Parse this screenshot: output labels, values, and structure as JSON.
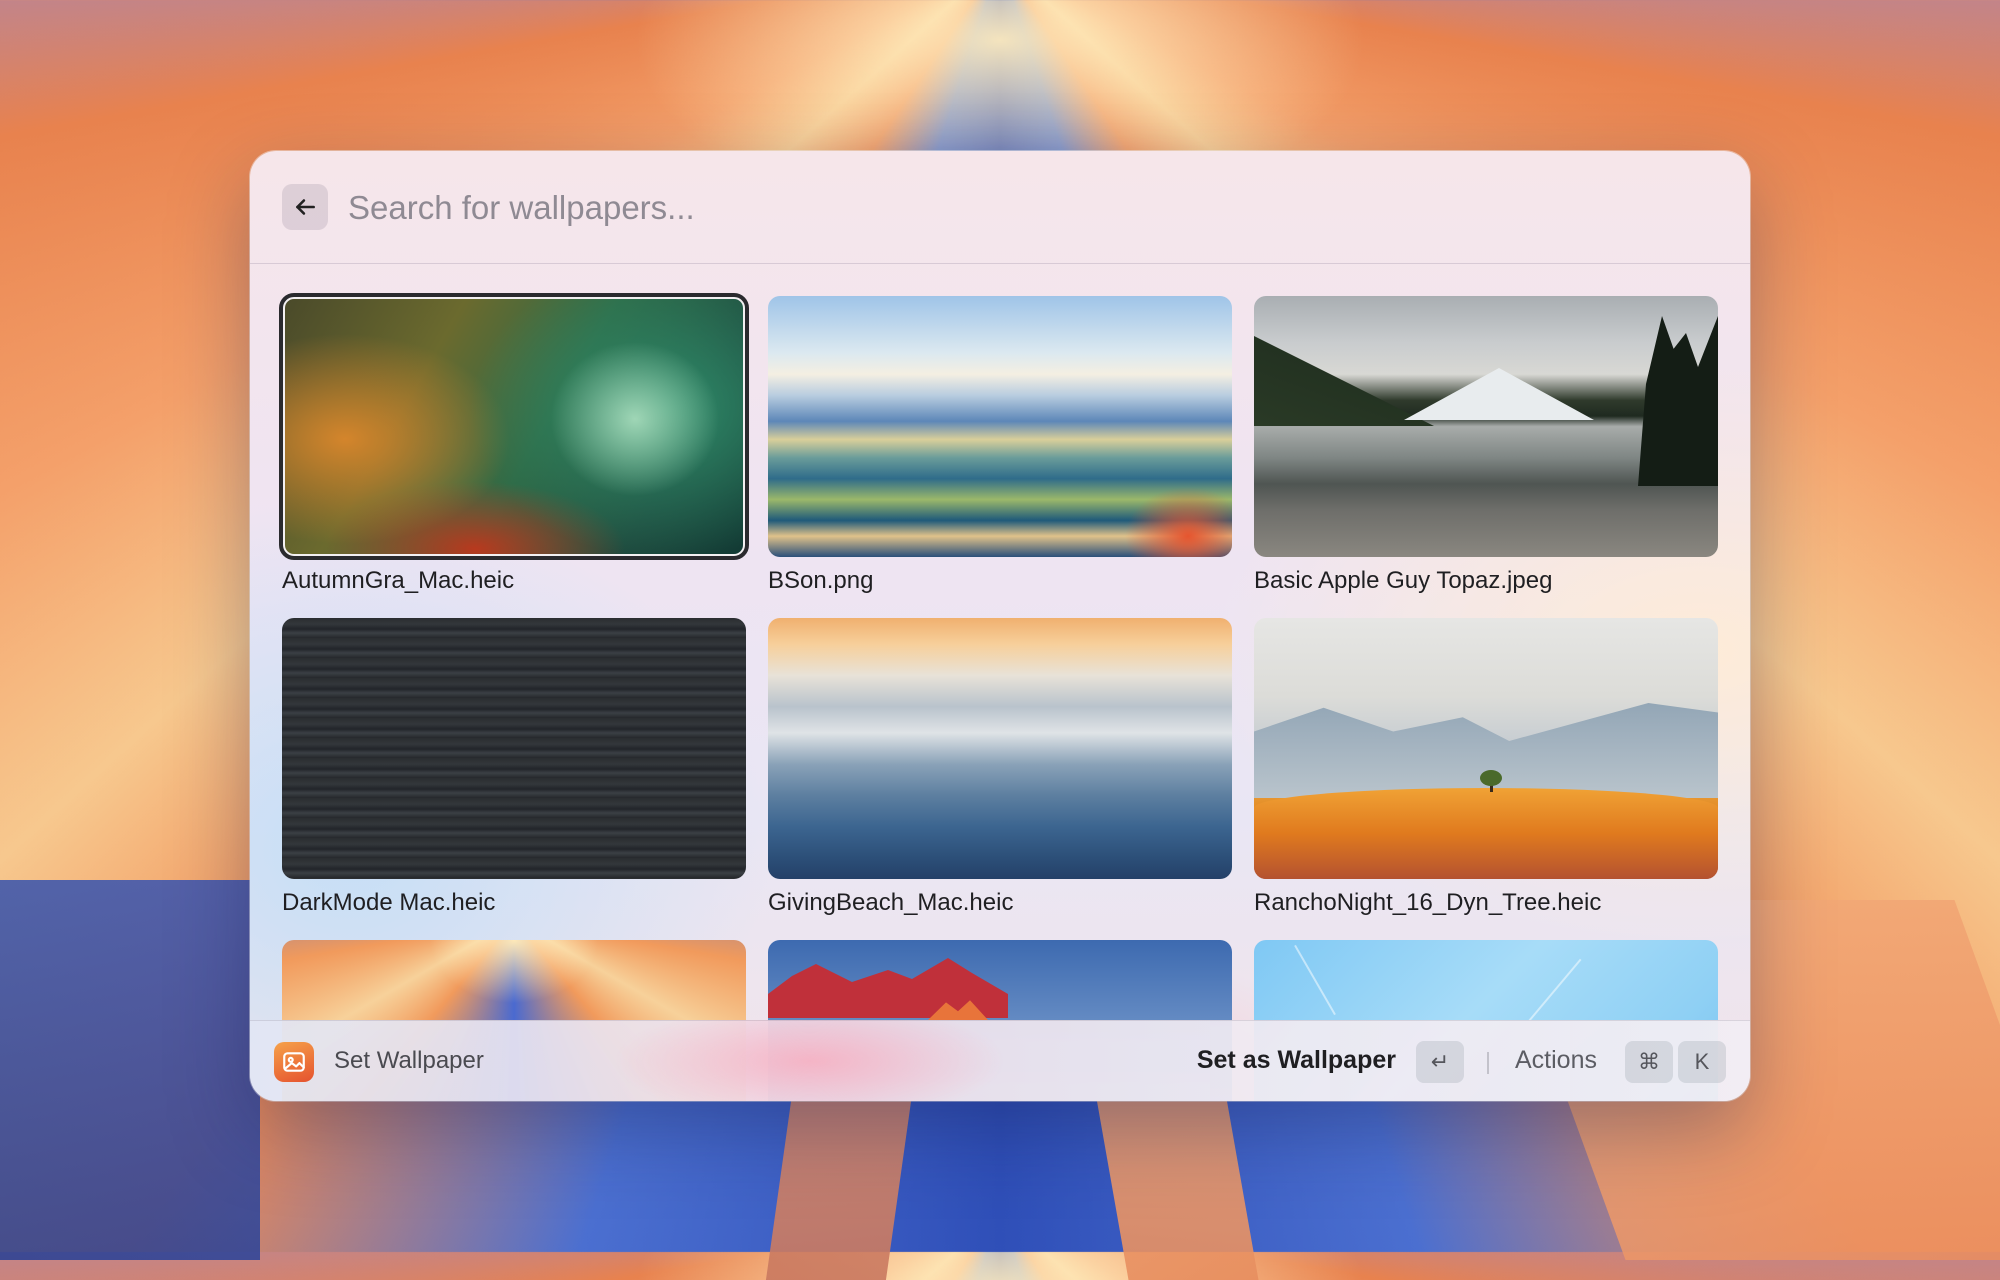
{
  "search": {
    "placeholder": "Search for wallpapers...",
    "value": ""
  },
  "icons": {
    "back": "arrow-left-icon",
    "app": "image-icon"
  },
  "wallpapers": [
    {
      "name": "AutumnGra_Mac.heic",
      "selected": true
    },
    {
      "name": "BSon.png",
      "selected": false
    },
    {
      "name": "Basic Apple Guy Topaz.jpeg",
      "selected": false
    },
    {
      "name": "DarkMode Mac.heic",
      "selected": false
    },
    {
      "name": "GivingBeach_Mac.heic",
      "selected": false
    },
    {
      "name": "RanchoNight_16_Dyn_Tree.heic",
      "selected": false
    },
    {
      "name": "",
      "selected": false
    },
    {
      "name": "",
      "selected": false
    },
    {
      "name": "",
      "selected": false
    }
  ],
  "footer": {
    "title": "Set Wallpaper",
    "primary_action": "Set as Wallpaper",
    "primary_key": "↵",
    "actions_label": "Actions",
    "actions_keys": [
      "⌘",
      "K"
    ]
  },
  "colors": {
    "app_icon": "#e5522e",
    "selection_outline": "#2a2a2e"
  }
}
